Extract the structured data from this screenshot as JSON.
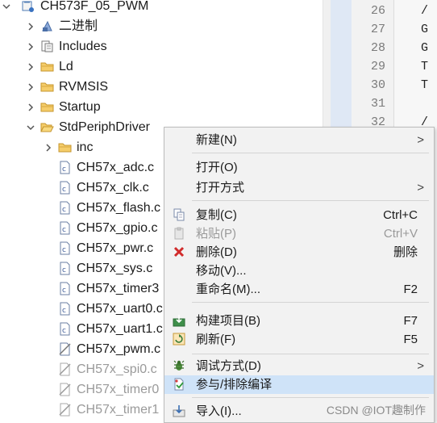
{
  "tree": {
    "project": "CH573F_05_PWM",
    "folders": [
      {
        "label": "二进制",
        "icon": "binaries-icon"
      },
      {
        "label": "Includes",
        "icon": "includes-icon"
      },
      {
        "label": "Ld",
        "icon": "folder-icon"
      },
      {
        "label": "RVMSIS",
        "icon": "folder-icon"
      },
      {
        "label": "Startup",
        "icon": "folder-icon"
      },
      {
        "label": "StdPeriphDriver",
        "icon": "folder-open-icon"
      }
    ],
    "subfolder": "inc",
    "files": [
      {
        "label": "CH57x_adc.c",
        "disabled": false
      },
      {
        "label": "CH57x_clk.c",
        "disabled": false
      },
      {
        "label": "CH57x_flash.c",
        "disabled": false
      },
      {
        "label": "CH57x_gpio.c",
        "disabled": false
      },
      {
        "label": "CH57x_pwr.c",
        "disabled": false
      },
      {
        "label": "CH57x_sys.c",
        "disabled": false
      },
      {
        "label": "CH57x_timer3",
        "disabled": false
      },
      {
        "label": "CH57x_uart0.c",
        "disabled": false
      },
      {
        "label": "CH57x_uart1.c",
        "disabled": false
      },
      {
        "label": "CH57x_pwm.c",
        "disabled": false
      },
      {
        "label": "CH57x_spi0.c",
        "disabled": true
      },
      {
        "label": "CH57x_timer0",
        "disabled": true
      },
      {
        "label": "CH57x_timer1",
        "disabled": true
      }
    ]
  },
  "editor": {
    "lines": [
      "26",
      "27",
      "28",
      "29",
      "30",
      "31",
      "32"
    ],
    "code": [
      "/",
      "G",
      "G",
      "T",
      "T",
      "",
      "/"
    ]
  },
  "menu": {
    "new": {
      "label": "新建(N)",
      "arrow": ">"
    },
    "open": {
      "label": "打开(O)"
    },
    "open_with": {
      "label": "打开方式",
      "arrow": ">"
    },
    "copy": {
      "label": "复制(C)",
      "shortcut": "Ctrl+C"
    },
    "paste": {
      "label": "粘贴(P)",
      "shortcut": "Ctrl+V"
    },
    "delete": {
      "label": "删除(D)",
      "shortcut": "删除"
    },
    "move": {
      "label": "移动(V)..."
    },
    "rename": {
      "label": "重命名(M)...",
      "shortcut": "F2"
    },
    "build": {
      "label": "构建项目(B)",
      "shortcut": "F7"
    },
    "refresh": {
      "label": "刷新(F)",
      "shortcut": "F5"
    },
    "debug_as": {
      "label": "调试方式(D)",
      "arrow": ">"
    },
    "exclude": {
      "label": "参与/排除编译"
    },
    "import": {
      "label": "导入(I)..."
    }
  },
  "watermark": "CSDN @IOT趣制作",
  "colors": {
    "highlight": "#cfe3f8",
    "folder": "#e8b84a",
    "delete_x": "#d12b2b"
  }
}
